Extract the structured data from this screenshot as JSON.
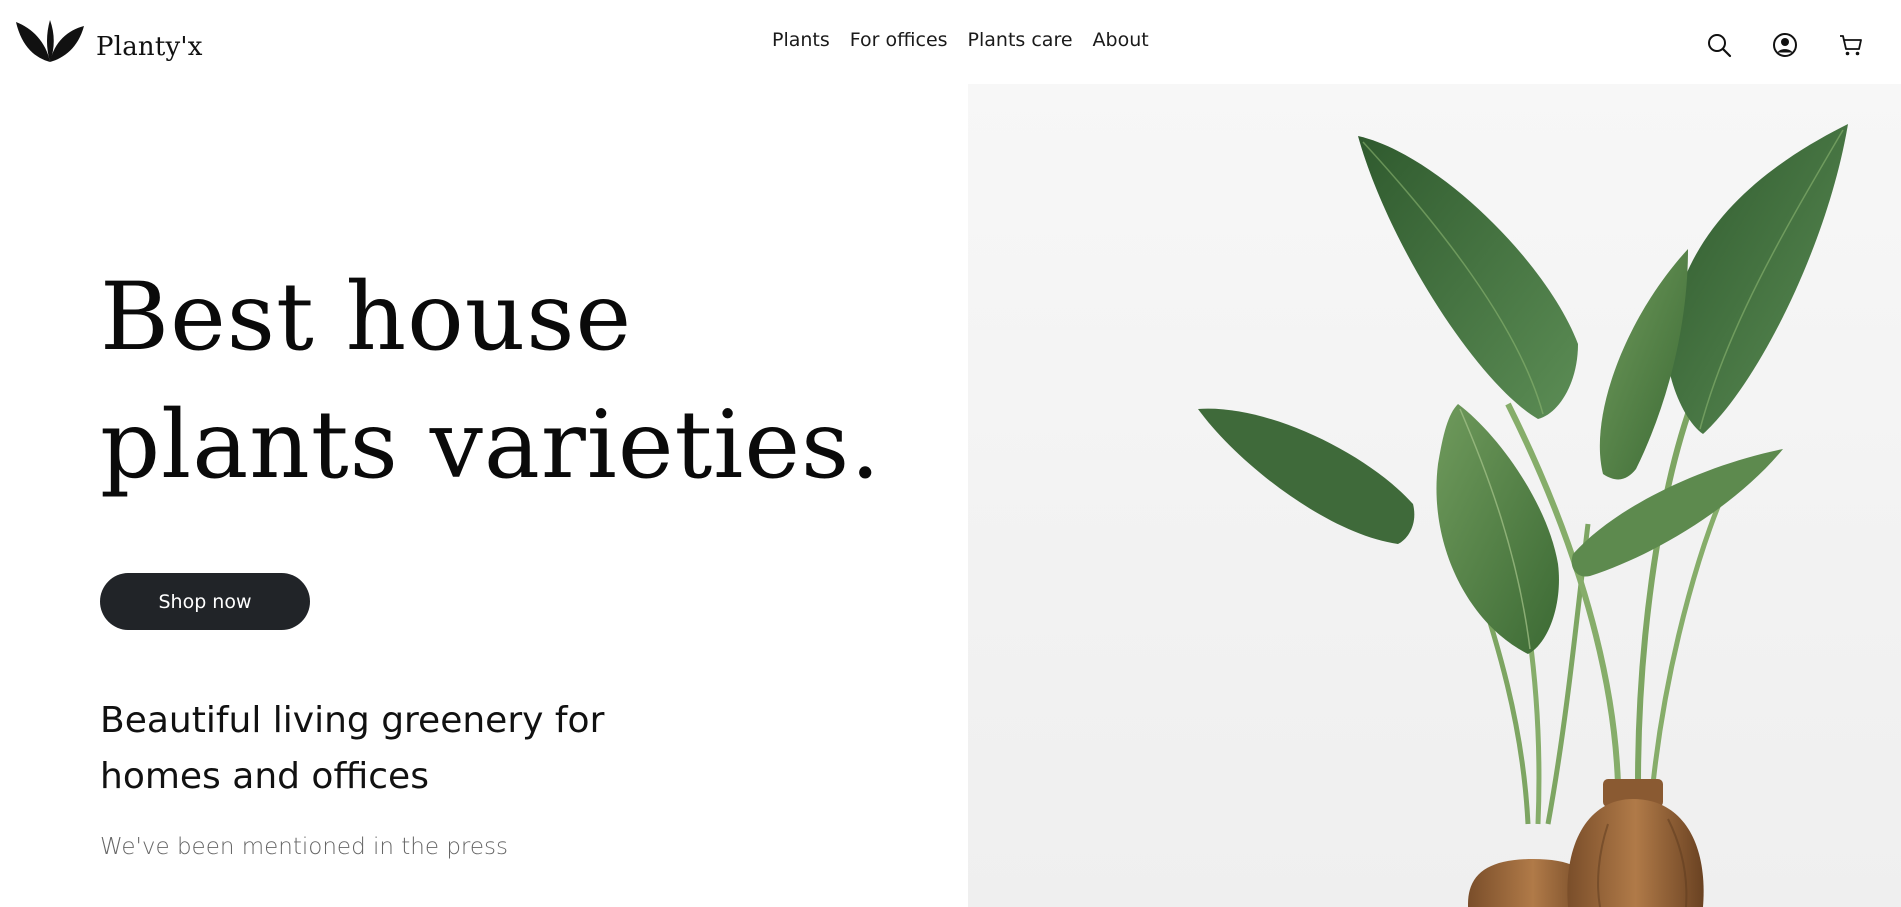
{
  "brand": {
    "name": "Planty'x",
    "logo_icon": "leaves-logo-icon"
  },
  "nav": {
    "items": [
      {
        "label": "Plants"
      },
      {
        "label": "For offices"
      },
      {
        "label": "Plants care"
      },
      {
        "label": "About"
      }
    ]
  },
  "header_icons": [
    "search-icon",
    "user-icon",
    "cart-icon"
  ],
  "hero": {
    "headline_line1": "Best house",
    "headline_line2": "plants varieties.",
    "cta_label": "Shop now",
    "subtitle": "Beautiful living greenery for homes and offices",
    "press_text": "We've been mentioned in the press"
  },
  "colors": {
    "button_bg": "#212428",
    "leaf_green": "#3f6b3c",
    "vase_wood": "#9a6a3e",
    "image_bg": "#f4f4f4"
  }
}
